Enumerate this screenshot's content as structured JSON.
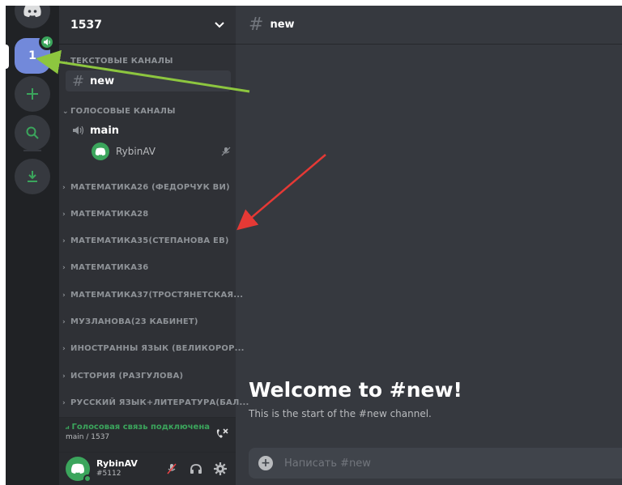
{
  "server": {
    "name": "1537",
    "active_icon_text": "1"
  },
  "categories": {
    "text": "ТЕКСТОВЫЕ КАНАЛЫ",
    "voice": "ГОЛОСОВЫЕ КАНАЛЫ",
    "collapsed": [
      "МАТЕМАТИКА26 (ФЕДОРЧУК ВИ)",
      "МАТЕМАТИКА28",
      "МАТЕМАТИКА35(СТЕПАНОВА ЕВ)",
      "МАТЕМАТИКА36",
      "МАТЕМАТИКА37(ТРОСТЯНЕТСКАЯ...",
      "МУЗЛАНОВА(23 КАБИНЕТ)",
      "ИНОСТРАННЫ ЯЗЫК (ВЕЛИКОРОР...",
      "ИСТОРИЯ (РАЗГУЛОВА)",
      "РУССКИЙ ЯЗЫК+ЛИТЕРАТУРА(БАЛ..."
    ]
  },
  "channels": {
    "text_channel": "new",
    "voice_channel": "main",
    "voice_user": "RybinAV"
  },
  "voice_panel": {
    "status": "Голосовая связь подключена",
    "location": "main / 1537"
  },
  "user": {
    "name": "RybinAV",
    "tag": "#5112"
  },
  "main": {
    "header_channel": "new",
    "welcome_title": "Welcome to #new!",
    "welcome_subtitle": "This is the start of the #new channel.",
    "composer_placeholder": "Написать #new"
  },
  "colors": {
    "accent": "#7289da",
    "online": "#3ba55c",
    "annotation_green": "#8dc63f",
    "annotation_red": "#e53935"
  }
}
